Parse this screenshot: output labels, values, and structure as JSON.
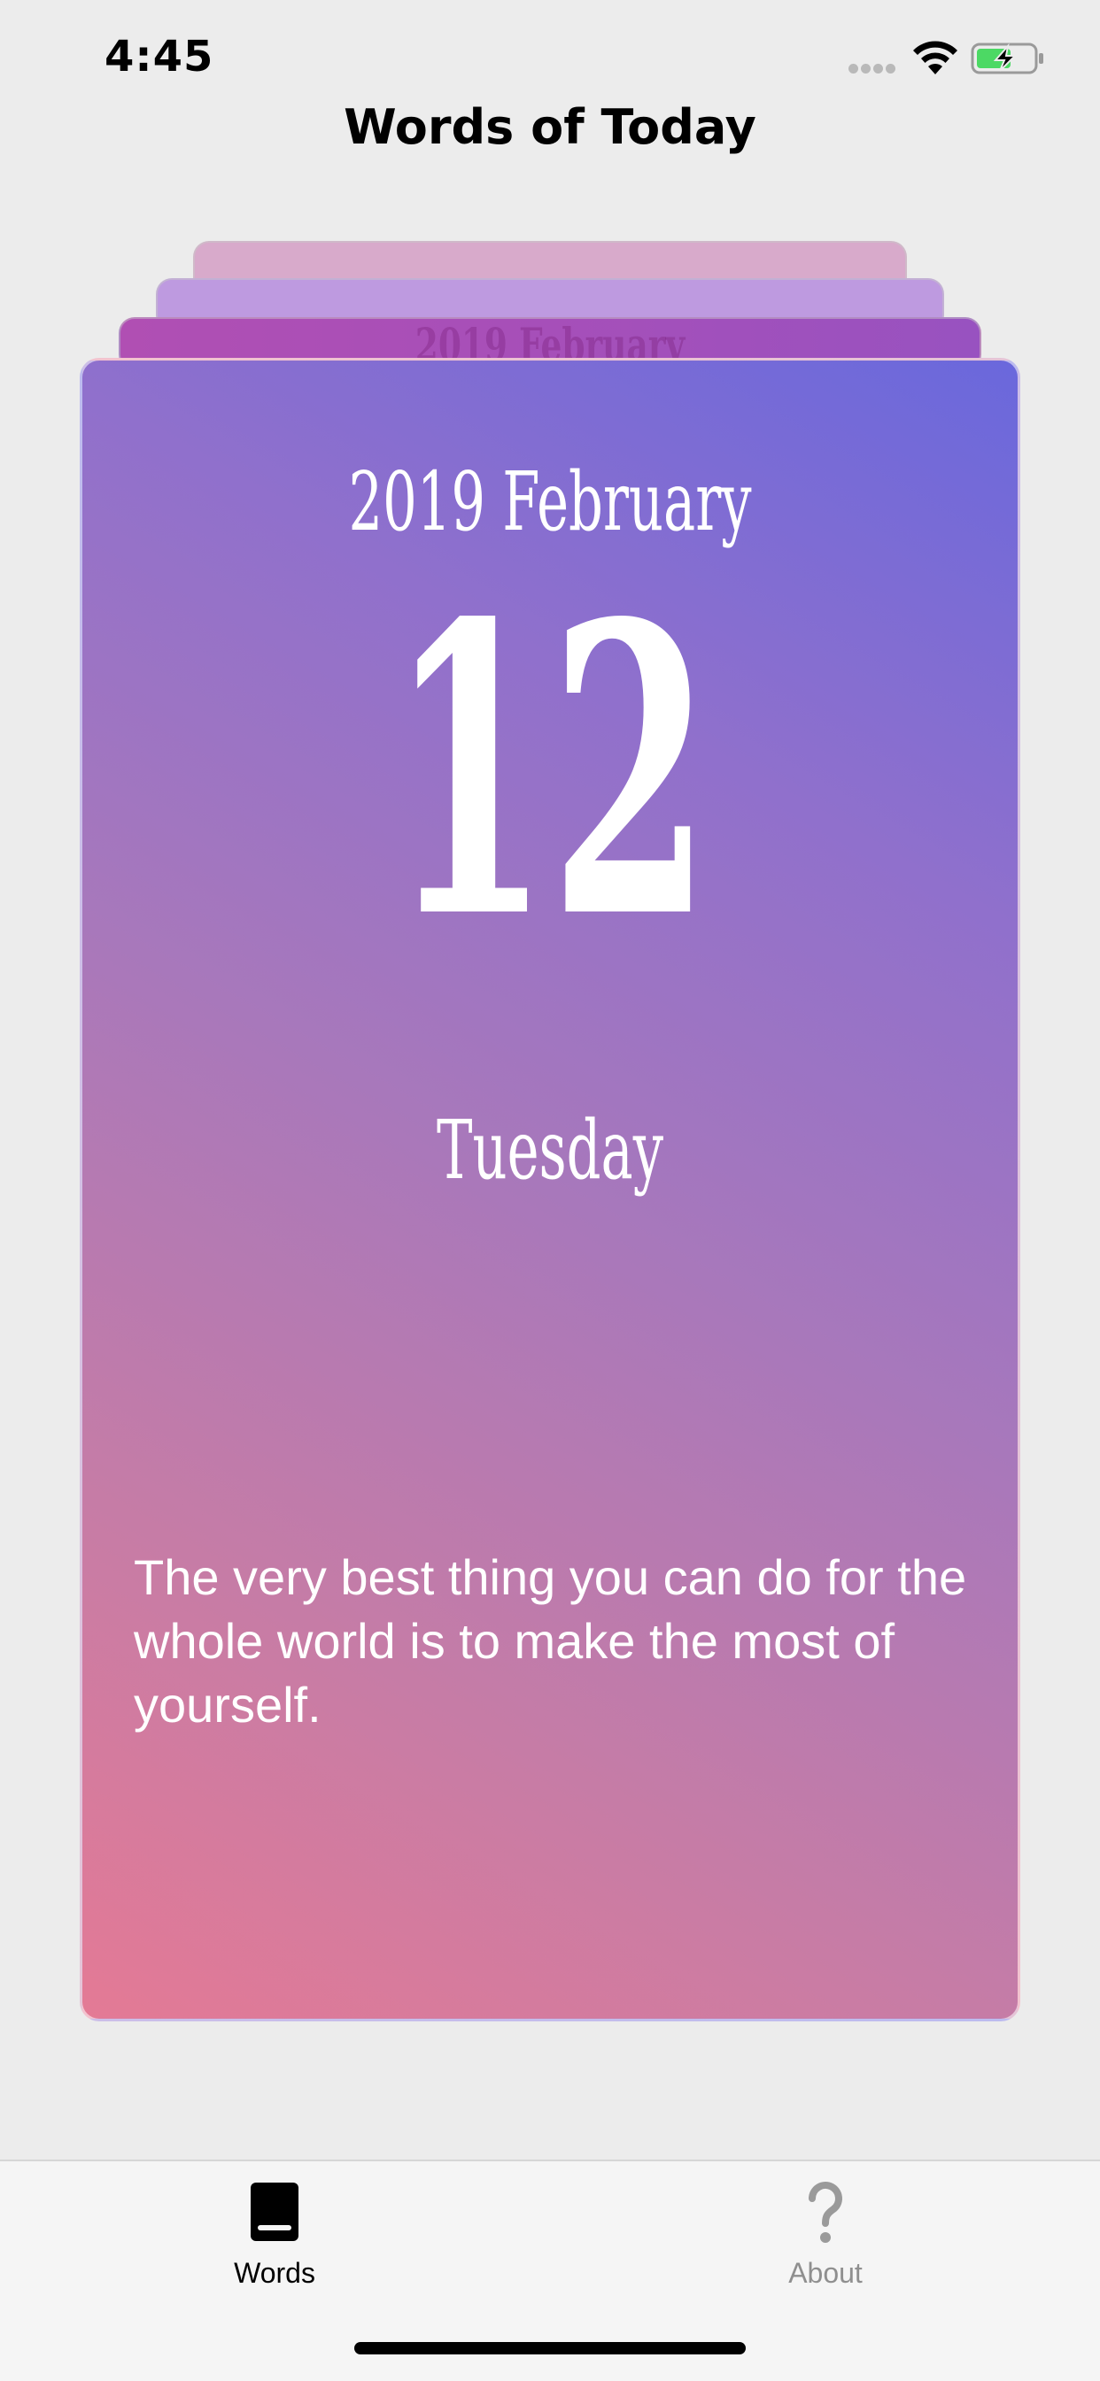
{
  "status_bar": {
    "time": "4:45"
  },
  "header": {
    "title": "Words of Today"
  },
  "cards": {
    "back_card_ghost_text": "2019 February",
    "main": {
      "month": "2019 February",
      "day": "12",
      "weekday": "Tuesday",
      "quote": "The very best thing you can do for the whole world is to make the most of yourself."
    }
  },
  "tab_bar": {
    "items": [
      {
        "label": "Words",
        "icon": "book-icon",
        "selected": true
      },
      {
        "label": "About",
        "icon": "question-mark-icon",
        "selected": false
      }
    ]
  },
  "colors": {
    "card_gradient_start": "#e47a95",
    "card_gradient_end": "#6a68dc",
    "background": "#ececec",
    "tab_active": "#000000",
    "tab_inactive": "#8f8f8f",
    "battery_fill": "#4cd964"
  }
}
